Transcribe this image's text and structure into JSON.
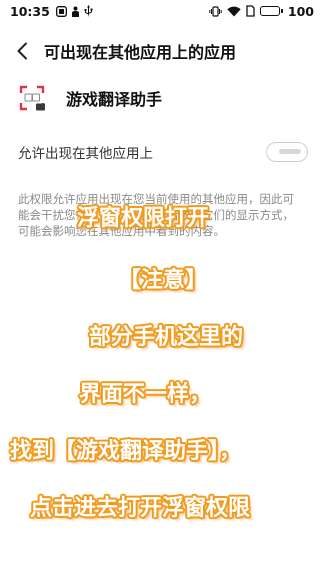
{
  "status_bar": {
    "time": "10:35",
    "battery_level": "100",
    "battery_fraction": 1.0,
    "icons": [
      "notification-badge-icon",
      "person-icon",
      "usb-icon",
      "vibrate-icon",
      "wifi-icon",
      "sim-icon",
      "battery-icon"
    ]
  },
  "header": {
    "title": "可出现在其他应用上的应用",
    "back_icon": "chevron-left-icon"
  },
  "app": {
    "name": "游戏翻译助手",
    "icon_badge": "翻"
  },
  "permission": {
    "label": "允许出现在其他应用上",
    "enabled": false
  },
  "description": {
    "text": "此权限允许应用出现在您当前使用的其他应用，因此可能会干扰您使用任何应用，或者改变它们的显示方式，可能会影响您在其他应用中看到的内容。"
  },
  "overlay_caption": {
    "lines": [
      "浮窗权限打开",
      "【注意】",
      "部分手机这里的",
      "界面不一样，",
      "找到【游戏翻译助手】，",
      "点击进去打开浮窗权限"
    ],
    "text_color": "#ffffff",
    "outline_color": "#f29a1c"
  }
}
